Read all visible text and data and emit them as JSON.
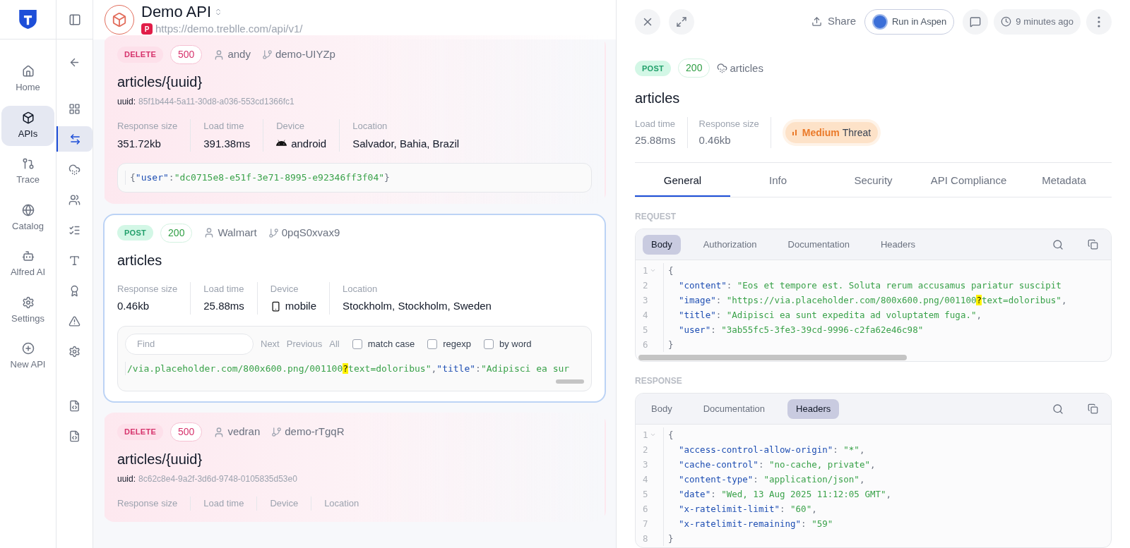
{
  "nav": {
    "items": [
      {
        "label": "Home",
        "selected": false
      },
      {
        "label": "APIs",
        "selected": true
      },
      {
        "label": "Trace",
        "selected": false
      },
      {
        "label": "Catalog",
        "selected": false
      },
      {
        "label": "Alfred AI",
        "selected": false
      },
      {
        "label": "Settings",
        "selected": false
      },
      {
        "label": "New API",
        "selected": false
      }
    ]
  },
  "rail": {
    "items": [
      {
        "selected": false
      },
      {
        "selected": false
      },
      {
        "selected": true
      },
      {
        "selected": false
      },
      {
        "selected": false
      },
      {
        "selected": false
      },
      {
        "selected": false
      },
      {
        "selected": false
      },
      {
        "selected": false
      },
      {
        "selected": false
      },
      {
        "selected": false
      },
      {
        "selected": false
      }
    ]
  },
  "header": {
    "title": "Demo API",
    "project_badge": "P",
    "url": "https://demo.treblle.com/api/v1/"
  },
  "requests": [
    {
      "selected": false,
      "method": {
        "label": "DELETE",
        "kind": "delete"
      },
      "status": {
        "label": "500",
        "kind": "error"
      },
      "user": "andy",
      "branch": "demo-UIYZp",
      "title": "articles/{uuid}",
      "param_label": "uuid:",
      "param_value": "85f1b444-5a11-30d8-a036-553cd1366fc1",
      "stats": [
        {
          "label": "Response size",
          "value": "351.72kb"
        },
        {
          "label": "Load time",
          "value": "391.38ms"
        },
        {
          "label": "Device",
          "value": "android",
          "kind": "android"
        },
        {
          "label": "Location",
          "value": "Salvador, Bahia, Brazil"
        }
      ],
      "code": {
        "tokens": [
          {
            "kind": "punct",
            "text": "{"
          },
          {
            "kind": "key",
            "text": "\"user\""
          },
          {
            "kind": "punct",
            "text": ":"
          },
          {
            "kind": "str",
            "text": "\"dc0715e8-e51f-3e71-8995-e92346ff3f04\""
          },
          {
            "kind": "punct",
            "text": "}"
          }
        ]
      }
    },
    {
      "selected": true,
      "method": {
        "label": "POST",
        "kind": "post"
      },
      "status": {
        "label": "200",
        "kind": "success"
      },
      "user": "Walmart",
      "branch": "0pqS0xvax9",
      "title": "articles",
      "stats": [
        {
          "label": "Response size",
          "value": "0.46kb"
        },
        {
          "label": "Load time",
          "value": "25.88ms"
        },
        {
          "label": "Device",
          "value": "mobile",
          "kind": "mobile"
        },
        {
          "label": "Location",
          "value": "Stockholm, Stockholm, Sweden"
        }
      ],
      "code": {
        "find": {
          "placeholder": "Find",
          "actions": [
            "Next",
            "Previous",
            "All"
          ],
          "options": [
            {
              "label": "match case",
              "checked": false
            },
            {
              "label": "regexp",
              "checked": false
            },
            {
              "label": "by word",
              "checked": false
            }
          ]
        },
        "tokens": [
          {
            "kind": "str",
            "text": "/via.placeholder.com/800x600.png/001100"
          },
          {
            "kind": "mark",
            "text": "?"
          },
          {
            "kind": "str",
            "text": "text=doloribus\""
          },
          {
            "kind": "punct",
            "text": ","
          },
          {
            "kind": "key",
            "text": "\"title\""
          },
          {
            "kind": "punct",
            "text": ":"
          },
          {
            "kind": "str",
            "text": "\"Adipisci ea sur"
          }
        ]
      }
    },
    {
      "selected": false,
      "method": {
        "label": "DELETE",
        "kind": "delete"
      },
      "status": {
        "label": "500",
        "kind": "error"
      },
      "user": "vedran",
      "branch": "demo-rTgqR",
      "title": "articles/{uuid}",
      "param_label": "uuid:",
      "param_value": "8c62c8e4-9a2f-3d6d-9748-0105835d53e0",
      "stats": [
        {
          "label": "Response size"
        },
        {
          "label": "Load time"
        },
        {
          "label": "Device"
        },
        {
          "label": "Location"
        }
      ]
    }
  ],
  "detail": {
    "share": "Share",
    "run": "Run in Aspen",
    "time": "9 minutes ago",
    "method": {
      "label": "POST",
      "kind": "post"
    },
    "status": {
      "label": "200",
      "kind": "success"
    },
    "endpoint": "articles",
    "title": "articles",
    "stats": [
      {
        "label": "Load time",
        "value": "25.88ms"
      },
      {
        "label": "Response size",
        "value": "0.46kb"
      }
    ],
    "threat": {
      "level": "Medium",
      "label": "Threat",
      "kind": "medium"
    },
    "tabs": [
      {
        "label": "General",
        "selected": true
      },
      {
        "label": "Info",
        "selected": false
      },
      {
        "label": "Security",
        "selected": false
      },
      {
        "label": "API Compliance",
        "selected": false
      },
      {
        "label": "Metadata",
        "selected": false
      }
    ],
    "request": {
      "heading": "REQUEST",
      "tabs": [
        {
          "label": "Body",
          "selected": true
        },
        {
          "label": "Authorization",
          "selected": false
        },
        {
          "label": "Documentation",
          "selected": false
        },
        {
          "label": "Headers",
          "selected": false
        }
      ],
      "scrollbar": true,
      "lines": [
        {
          "number": "1",
          "fold": true,
          "tokens": [
            {
              "kind": "punct",
              "text": "{"
            }
          ]
        },
        {
          "number": "2",
          "tokens": [
            {
              "kind": "key",
              "text": "\"content\""
            },
            {
              "kind": "punct",
              "text": ": "
            },
            {
              "kind": "str",
              "text": "\"Eos et tempore est. Soluta rerum accusamus pariatur suscipit"
            }
          ]
        },
        {
          "number": "3",
          "tokens": [
            {
              "kind": "key",
              "text": "\"image\""
            },
            {
              "kind": "punct",
              "text": ": "
            },
            {
              "kind": "str",
              "text": "\"https://via.placeholder.com/800x600.png/001100"
            },
            {
              "kind": "mark",
              "text": "?"
            },
            {
              "kind": "str",
              "text": "text=doloribus\""
            },
            {
              "kind": "punct",
              "text": ","
            }
          ]
        },
        {
          "number": "4",
          "tokens": [
            {
              "kind": "key",
              "text": "\"title\""
            },
            {
              "kind": "punct",
              "text": ": "
            },
            {
              "kind": "str",
              "text": "\"Adipisci ea sunt expedita ad voluptatem fuga.\""
            },
            {
              "kind": "punct",
              "text": ","
            }
          ]
        },
        {
          "number": "5",
          "tokens": [
            {
              "kind": "key",
              "text": "\"user\""
            },
            {
              "kind": "punct",
              "text": ": "
            },
            {
              "kind": "str",
              "text": "\"3ab55fc5-3fe3-39cd-9996-c2fa62e46c98\""
            }
          ]
        },
        {
          "number": "6",
          "tokens": [
            {
              "kind": "punct",
              "text": "}"
            }
          ]
        }
      ]
    },
    "response": {
      "heading": "RESPONSE",
      "tabs": [
        {
          "label": "Body",
          "selected": false
        },
        {
          "label": "Documentation",
          "selected": false
        },
        {
          "label": "Headers",
          "selected": true
        }
      ],
      "lines": [
        {
          "number": "1",
          "fold": true,
          "tokens": [
            {
              "kind": "punct",
              "text": "{"
            }
          ]
        },
        {
          "number": "2",
          "tokens": [
            {
              "kind": "key",
              "text": "\"access-control-allow-origin\""
            },
            {
              "kind": "punct",
              "text": ": "
            },
            {
              "kind": "str",
              "text": "\"*\""
            },
            {
              "kind": "punct",
              "text": ","
            }
          ]
        },
        {
          "number": "3",
          "tokens": [
            {
              "kind": "key",
              "text": "\"cache-control\""
            },
            {
              "kind": "punct",
              "text": ": "
            },
            {
              "kind": "str",
              "text": "\"no-cache, private\""
            },
            {
              "kind": "punct",
              "text": ","
            }
          ]
        },
        {
          "number": "4",
          "tokens": [
            {
              "kind": "key",
              "text": "\"content-type\""
            },
            {
              "kind": "punct",
              "text": ": "
            },
            {
              "kind": "str",
              "text": "\"application/json\""
            },
            {
              "kind": "punct",
              "text": ","
            }
          ]
        },
        {
          "number": "5",
          "tokens": [
            {
              "kind": "key",
              "text": "\"date\""
            },
            {
              "kind": "punct",
              "text": ": "
            },
            {
              "kind": "str",
              "text": "\"Wed, 13 Aug 2025 11:12:05 GMT\""
            },
            {
              "kind": "punct",
              "text": ","
            }
          ]
        },
        {
          "number": "6",
          "tokens": [
            {
              "kind": "key",
              "text": "\"x-ratelimit-limit\""
            },
            {
              "kind": "punct",
              "text": ": "
            },
            {
              "kind": "str",
              "text": "\"60\""
            },
            {
              "kind": "punct",
              "text": ","
            }
          ]
        },
        {
          "number": "7",
          "tokens": [
            {
              "kind": "key",
              "text": "\"x-ratelimit-remaining\""
            },
            {
              "kind": "punct",
              "text": ": "
            },
            {
              "kind": "str",
              "text": "\"59\""
            }
          ]
        },
        {
          "number": "8",
          "tokens": [
            {
              "kind": "punct",
              "text": "}"
            }
          ]
        }
      ]
    }
  }
}
